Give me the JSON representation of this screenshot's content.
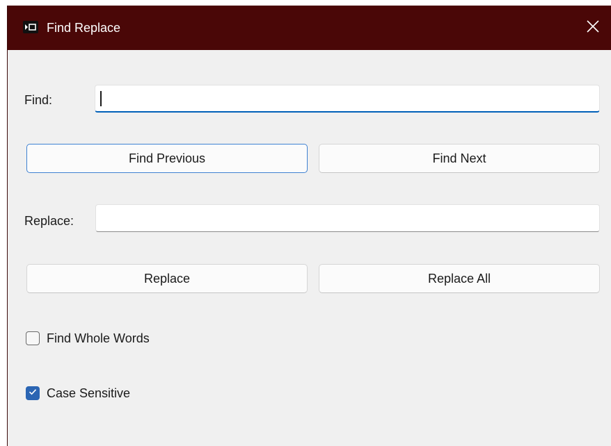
{
  "window": {
    "title": "Find Replace",
    "icon": "app-window-icon",
    "close_icon": "close-icon"
  },
  "find": {
    "label": "Find:",
    "value": "",
    "placeholder": ""
  },
  "find_buttons": {
    "previous_label": "Find Previous",
    "next_label": "Find Next"
  },
  "replace": {
    "label": "Replace:",
    "value": "",
    "placeholder": ""
  },
  "replace_buttons": {
    "replace_label": "Replace",
    "replace_all_label": "Replace All"
  },
  "options": {
    "whole_words": {
      "label": "Find Whole Words",
      "checked": false
    },
    "case_sensitive": {
      "label": "Case Sensitive",
      "checked": true
    }
  },
  "colors": {
    "titlebar": "#4a0707",
    "accent": "#2b65b3",
    "background": "#f0f0f0"
  }
}
